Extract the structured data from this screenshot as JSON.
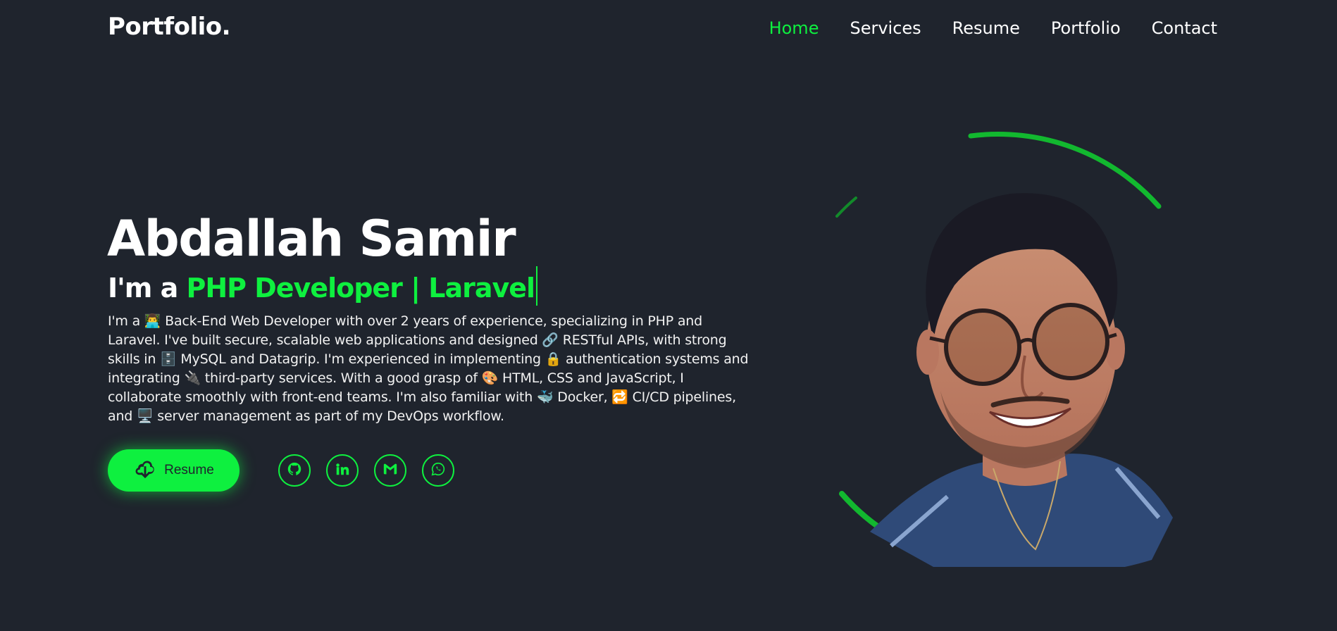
{
  "header": {
    "logo": "Portfolio.",
    "nav": [
      {
        "label": "Home",
        "active": true
      },
      {
        "label": "Services",
        "active": false
      },
      {
        "label": "Resume",
        "active": false
      },
      {
        "label": "Portfolio",
        "active": false
      },
      {
        "label": "Contact",
        "active": false
      }
    ]
  },
  "hero": {
    "name": "Abdallah Samir",
    "role_prefix": "I'm a ",
    "role_highlight": "PHP Developer | Laravel",
    "description": "I'm a 👨‍💻 Back-End Web Developer with over 2 years of experience, specializing in PHP and Laravel. I've built secure, scalable web applications and designed 🔗 RESTful APIs, with strong skills in 🗄️ MySQL and Datagrip. I'm experienced in implementing 🔒 authentication systems and integrating 🔌 third-party services. With a good grasp of 🎨 HTML, CSS and JavaScript, I collaborate smoothly with front-end teams. I'm also familiar with 🐳 Docker, 🔁 CI/CD pipelines, and 🖥️ server management as part of my DevOps workflow.",
    "resume_button": "Resume",
    "socials": [
      "github-icon",
      "linkedin-icon",
      "gmail-icon",
      "whatsapp-icon"
    ]
  },
  "colors": {
    "background": "#1f242d",
    "accent": "#0ef03f",
    "text": "#ffffff"
  }
}
